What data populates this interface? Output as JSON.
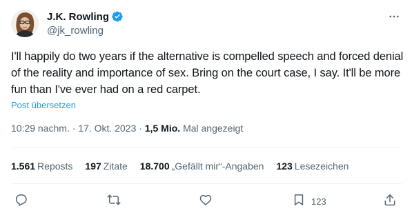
{
  "author": {
    "name": "J.K. Rowling",
    "handle": "@jk_rowling",
    "verified": true
  },
  "tweet": {
    "text": "I'll happily do two years if the alternative is compelled speech and forced denial of the reality and importance of sex. Bring on the court case, I say. It'll be more fun than I've ever had on a red carpet.",
    "translate_label": "Post übersetzen"
  },
  "meta": {
    "time": "10:29 nachm.",
    "separator": "·",
    "date": "17. Okt. 2023",
    "views_count": "1,5 Mio.",
    "views_label": "Mal angezeigt"
  },
  "stats": [
    {
      "count": "1.561",
      "label": "Reposts"
    },
    {
      "count": "197",
      "label": "Zitate"
    },
    {
      "count": "18.700",
      "label": "„Gefällt mir“-Angaben"
    },
    {
      "count": "123",
      "label": "Lesezeichen"
    }
  ],
  "actions": {
    "reply_icon": "reply-icon",
    "repost_icon": "repost-icon",
    "like_icon": "heart-icon",
    "bookmark_icon": "bookmark-icon",
    "bookmark_count": "123",
    "share_icon": "share-icon"
  },
  "colors": {
    "text": "#0f1419",
    "secondary": "#536471",
    "accent": "#1d9bf0",
    "divider": "#eff3f4"
  }
}
